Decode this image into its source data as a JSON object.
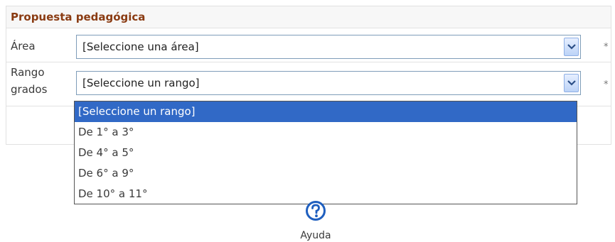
{
  "section": {
    "title": "Propuesta pedagógica"
  },
  "fields": {
    "area": {
      "label": "Área",
      "value": "[Seleccione una área]",
      "required": "*"
    },
    "rango": {
      "label_line1": "Rango",
      "label_line2": "grados",
      "value": "[Seleccione un rango]",
      "required": "*"
    }
  },
  "dropdown": {
    "options": [
      "[Seleccione un rango]",
      "De 1° a 3°",
      "De 4° a 5°",
      "De 6° a 9°",
      "De 10° a 11°"
    ],
    "selected_index": 0
  },
  "help": {
    "label": "Ayuda",
    "icon": "question-circle-icon"
  },
  "colors": {
    "title": "#8a3b12",
    "selection": "#3169c6",
    "help": "#1f5fbf"
  }
}
